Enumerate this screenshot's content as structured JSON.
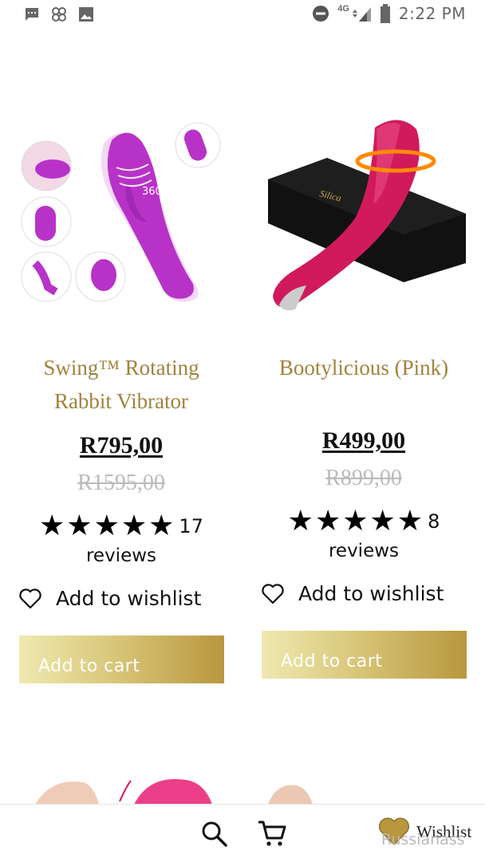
{
  "status_bar": {
    "time": "2:22 PM",
    "network": "4G"
  },
  "products": [
    {
      "title": "Swing™ Rotating Rabbit Vibrator",
      "image_badge": "360°",
      "price": "R795,00",
      "old_price": "R1595,00",
      "rating_stars": 5,
      "review_count": "17",
      "reviews_label": "reviews",
      "wishlist_label": "Add to wishlist",
      "cart_label": "Add to cart"
    },
    {
      "title": "Bootylicious (Pink)",
      "price": "R499,00",
      "old_price": "R899,00",
      "rating_stars": 5,
      "review_count": "8",
      "reviews_label": "reviews",
      "wishlist_label": "Add to wishlist",
      "cart_label": "Add to cart"
    }
  ],
  "bottom_bar": {
    "wishlist_label": "Wishlist"
  },
  "watermark": "Russianass",
  "colors": {
    "title": "#a2823d",
    "button_start": "#efe9b0",
    "button_end": "#b8973e",
    "product_left": "#b832c8",
    "product_right": "#d01a5c"
  }
}
